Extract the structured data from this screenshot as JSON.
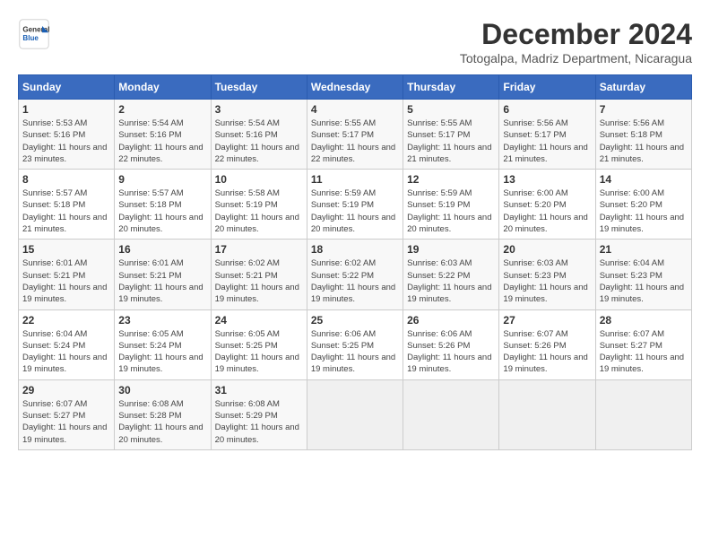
{
  "header": {
    "logo_line1": "General",
    "logo_line2": "Blue",
    "month_title": "December 2024",
    "location": "Totogalpa, Madriz Department, Nicaragua"
  },
  "calendar": {
    "weekdays": [
      "Sunday",
      "Monday",
      "Tuesday",
      "Wednesday",
      "Thursday",
      "Friday",
      "Saturday"
    ],
    "weeks": [
      [
        {
          "day": "",
          "empty": true
        },
        {
          "day": "",
          "empty": true
        },
        {
          "day": "",
          "empty": true
        },
        {
          "day": "",
          "empty": true
        },
        {
          "day": "",
          "empty": true
        },
        {
          "day": "",
          "empty": true
        },
        {
          "day": "",
          "empty": true
        }
      ],
      [
        {
          "day": "1",
          "sunrise": "5:53 AM",
          "sunset": "5:16 PM",
          "daylight": "11 hours and 23 minutes."
        },
        {
          "day": "2",
          "sunrise": "5:54 AM",
          "sunset": "5:16 PM",
          "daylight": "11 hours and 22 minutes."
        },
        {
          "day": "3",
          "sunrise": "5:54 AM",
          "sunset": "5:16 PM",
          "daylight": "11 hours and 22 minutes."
        },
        {
          "day": "4",
          "sunrise": "5:55 AM",
          "sunset": "5:17 PM",
          "daylight": "11 hours and 22 minutes."
        },
        {
          "day": "5",
          "sunrise": "5:55 AM",
          "sunset": "5:17 PM",
          "daylight": "11 hours and 21 minutes."
        },
        {
          "day": "6",
          "sunrise": "5:56 AM",
          "sunset": "5:17 PM",
          "daylight": "11 hours and 21 minutes."
        },
        {
          "day": "7",
          "sunrise": "5:56 AM",
          "sunset": "5:18 PM",
          "daylight": "11 hours and 21 minutes."
        }
      ],
      [
        {
          "day": "8",
          "sunrise": "5:57 AM",
          "sunset": "5:18 PM",
          "daylight": "11 hours and 21 minutes."
        },
        {
          "day": "9",
          "sunrise": "5:57 AM",
          "sunset": "5:18 PM",
          "daylight": "11 hours and 20 minutes."
        },
        {
          "day": "10",
          "sunrise": "5:58 AM",
          "sunset": "5:19 PM",
          "daylight": "11 hours and 20 minutes."
        },
        {
          "day": "11",
          "sunrise": "5:59 AM",
          "sunset": "5:19 PM",
          "daylight": "11 hours and 20 minutes."
        },
        {
          "day": "12",
          "sunrise": "5:59 AM",
          "sunset": "5:19 PM",
          "daylight": "11 hours and 20 minutes."
        },
        {
          "day": "13",
          "sunrise": "6:00 AM",
          "sunset": "5:20 PM",
          "daylight": "11 hours and 20 minutes."
        },
        {
          "day": "14",
          "sunrise": "6:00 AM",
          "sunset": "5:20 PM",
          "daylight": "11 hours and 19 minutes."
        }
      ],
      [
        {
          "day": "15",
          "sunrise": "6:01 AM",
          "sunset": "5:21 PM",
          "daylight": "11 hours and 19 minutes."
        },
        {
          "day": "16",
          "sunrise": "6:01 AM",
          "sunset": "5:21 PM",
          "daylight": "11 hours and 19 minutes."
        },
        {
          "day": "17",
          "sunrise": "6:02 AM",
          "sunset": "5:21 PM",
          "daylight": "11 hours and 19 minutes."
        },
        {
          "day": "18",
          "sunrise": "6:02 AM",
          "sunset": "5:22 PM",
          "daylight": "11 hours and 19 minutes."
        },
        {
          "day": "19",
          "sunrise": "6:03 AM",
          "sunset": "5:22 PM",
          "daylight": "11 hours and 19 minutes."
        },
        {
          "day": "20",
          "sunrise": "6:03 AM",
          "sunset": "5:23 PM",
          "daylight": "11 hours and 19 minutes."
        },
        {
          "day": "21",
          "sunrise": "6:04 AM",
          "sunset": "5:23 PM",
          "daylight": "11 hours and 19 minutes."
        }
      ],
      [
        {
          "day": "22",
          "sunrise": "6:04 AM",
          "sunset": "5:24 PM",
          "daylight": "11 hours and 19 minutes."
        },
        {
          "day": "23",
          "sunrise": "6:05 AM",
          "sunset": "5:24 PM",
          "daylight": "11 hours and 19 minutes."
        },
        {
          "day": "24",
          "sunrise": "6:05 AM",
          "sunset": "5:25 PM",
          "daylight": "11 hours and 19 minutes."
        },
        {
          "day": "25",
          "sunrise": "6:06 AM",
          "sunset": "5:25 PM",
          "daylight": "11 hours and 19 minutes."
        },
        {
          "day": "26",
          "sunrise": "6:06 AM",
          "sunset": "5:26 PM",
          "daylight": "11 hours and 19 minutes."
        },
        {
          "day": "27",
          "sunrise": "6:07 AM",
          "sunset": "5:26 PM",
          "daylight": "11 hours and 19 minutes."
        },
        {
          "day": "28",
          "sunrise": "6:07 AM",
          "sunset": "5:27 PM",
          "daylight": "11 hours and 19 minutes."
        }
      ],
      [
        {
          "day": "29",
          "sunrise": "6:07 AM",
          "sunset": "5:27 PM",
          "daylight": "11 hours and 19 minutes."
        },
        {
          "day": "30",
          "sunrise": "6:08 AM",
          "sunset": "5:28 PM",
          "daylight": "11 hours and 20 minutes."
        },
        {
          "day": "31",
          "sunrise": "6:08 AM",
          "sunset": "5:29 PM",
          "daylight": "11 hours and 20 minutes."
        },
        {
          "day": "",
          "empty": true
        },
        {
          "day": "",
          "empty": true
        },
        {
          "day": "",
          "empty": true
        },
        {
          "day": "",
          "empty": true
        }
      ]
    ]
  }
}
